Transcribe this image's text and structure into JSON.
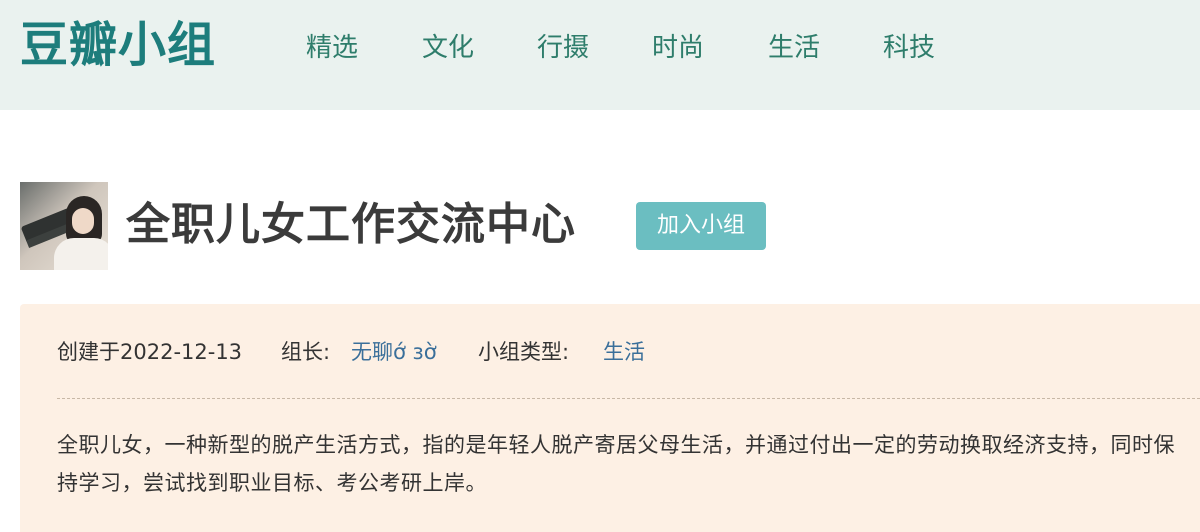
{
  "site": {
    "logo": "豆瓣小组"
  },
  "nav": {
    "items": [
      "精选",
      "文化",
      "行摄",
      "时尚",
      "生活",
      "科技"
    ]
  },
  "group": {
    "title": "全职儿女工作交流中心",
    "join_label": "加入小组",
    "created_text": "创建于2022-12-13",
    "leader_label": "组长:",
    "leader_name": "无聊ớ ɜờ",
    "type_label": "小组类型:",
    "type_value": "生活",
    "description": "全职儿女，一种新型的脱产生活方式，指的是年轻人脱产寄居父母生活，并通过付出一定的劳动换取经济支持，同时保持学习，尝试找到职业目标、考公考研上岸。"
  },
  "colors": {
    "header_bg": "#eaf2ef",
    "logo": "#1d7d7c",
    "nav_text": "#2e7d6b",
    "join_button_bg": "#6bbec1",
    "info_bg": "#fdf0e4",
    "link": "#3a6f9a"
  }
}
